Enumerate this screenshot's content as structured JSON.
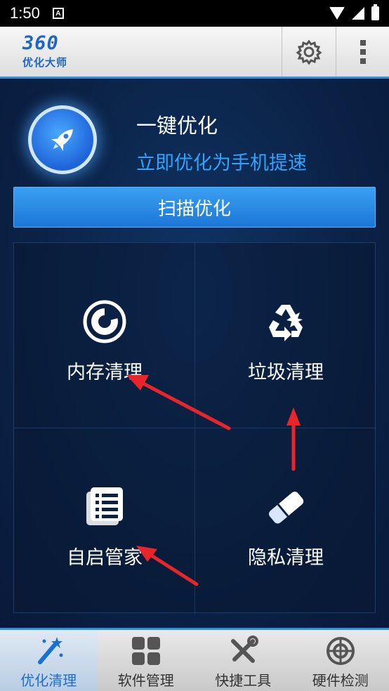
{
  "status_bar": {
    "time": "1:50",
    "notification_glyph": "A"
  },
  "app_bar": {
    "logo_number": "360",
    "logo_text": "优化大师"
  },
  "optimize": {
    "title": "一键优化",
    "subtitle": "立即优化为手机提速",
    "scan_button_label": "扫描优化"
  },
  "tools": [
    {
      "label": "内存清理",
      "icon": "memory-clean-icon"
    },
    {
      "label": "垃圾清理",
      "icon": "recycle-icon"
    },
    {
      "label": "自启管家",
      "icon": "list-doc-icon"
    },
    {
      "label": "隐私清理",
      "icon": "eraser-icon"
    }
  ],
  "bottom_nav": [
    {
      "label": "优化清理",
      "icon": "magic-wand-icon",
      "active": true
    },
    {
      "label": "软件管理",
      "icon": "apps-grid-icon",
      "active": false
    },
    {
      "label": "快捷工具",
      "icon": "tools-icon",
      "active": false
    },
    {
      "label": "硬件检测",
      "icon": "crosshair-icon",
      "active": false
    }
  ],
  "colors": {
    "accent": "#2d8fe0",
    "subtitle": "#2fa3ff",
    "background": "#0a1c3a",
    "annotation_arrow": "#e8262a"
  }
}
